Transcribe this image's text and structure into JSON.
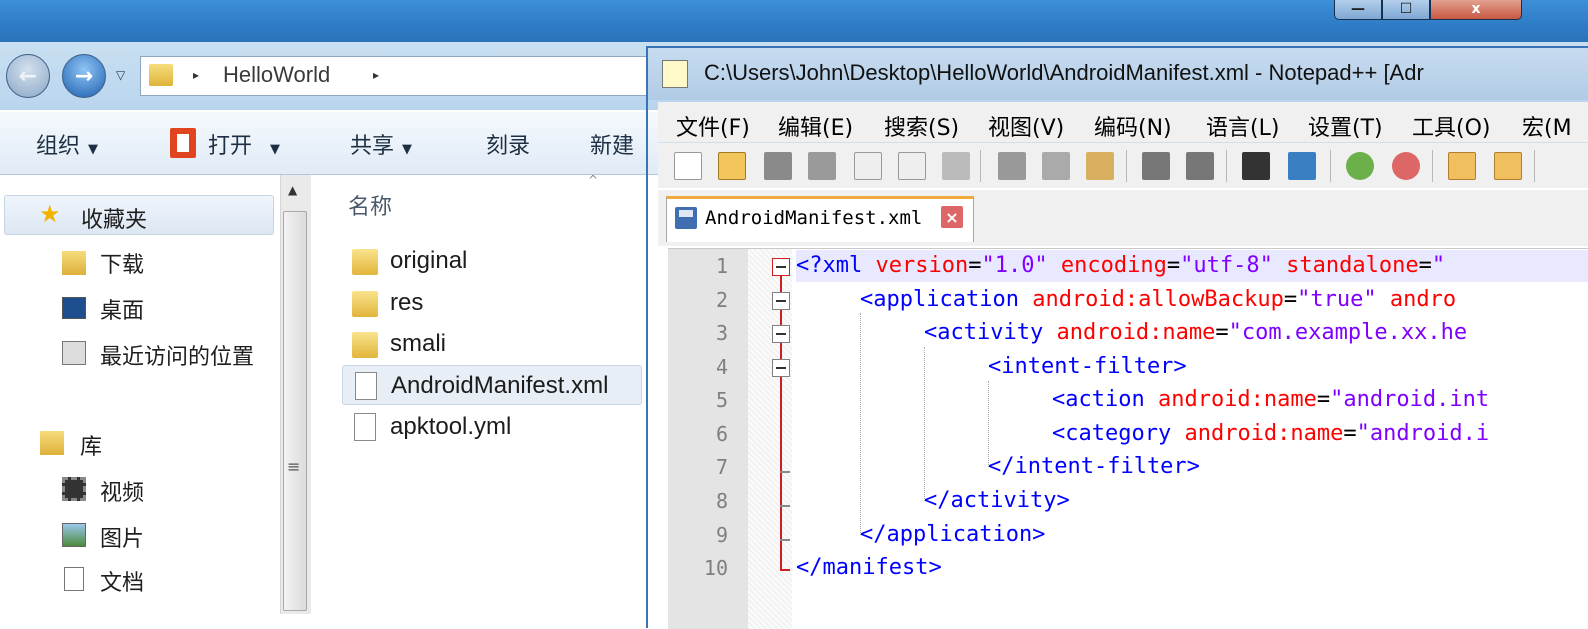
{
  "explorer": {
    "window_controls": {
      "minimize": "—",
      "maximize": "☐",
      "close": "x"
    },
    "address": {
      "segment": "HelloWorld",
      "arrow": "▸"
    },
    "toolbar": {
      "organize": "组织",
      "open": "打开",
      "share": "共享",
      "burn": "刻录",
      "new_folder": "新建",
      "dropdown": "▼"
    },
    "nav": {
      "favorites": "收藏夹",
      "downloads": "下载",
      "desktop": "桌面",
      "recent": "最近访问的位置",
      "libraries": "库",
      "videos": "视频",
      "pictures": "图片",
      "documents": "文档"
    },
    "file_list": {
      "column_name": "名称",
      "items": [
        "original",
        "res",
        "smali",
        "AndroidManifest.xml",
        "apktool.yml"
      ],
      "selected": "AndroidManifest.xml"
    }
  },
  "notepad": {
    "title": "C:\\Users\\John\\Desktop\\HelloWorld\\AndroidManifest.xml - Notepad++ [Adr",
    "menu": [
      "文件(F)",
      "编辑(E)",
      "搜索(S)",
      "视图(V)",
      "编码(N)",
      "语言(L)",
      "设置(T)",
      "工具(O)",
      "宏(M"
    ],
    "tab": {
      "label": "AndroidManifest.xml",
      "close": "×"
    },
    "line_numbers": [
      "1",
      "2",
      "3",
      "4",
      "5",
      "6",
      "7",
      "8",
      "9",
      "10"
    ],
    "code": {
      "l1": [
        "<?xml",
        " version",
        "=",
        "\"1.0\"",
        " encoding",
        "=",
        "\"utf-8\"",
        " standalone",
        "=",
        "\""
      ],
      "l2": [
        "<application",
        " android:allowBackup",
        "=",
        "\"true\"",
        " andro"
      ],
      "l3": [
        "<activity",
        " android:name",
        "=",
        "\"com.example.xx.he"
      ],
      "l4": [
        "<intent-filter>"
      ],
      "l5": [
        "<action",
        " android:name",
        "=",
        "\"android.int"
      ],
      "l6": [
        "<category",
        " android:name",
        "=",
        "\"android.i"
      ],
      "l7": [
        "</intent-filter>"
      ],
      "l8": [
        "</activity>"
      ],
      "l9": [
        "</application>"
      ],
      "l10": [
        "</manifest>"
      ]
    }
  },
  "colors": {
    "xml_tag": "#0000ff",
    "xml_attr": "#ff0000",
    "xml_value": "#8000ff",
    "current_line": "#e8e8ff"
  }
}
